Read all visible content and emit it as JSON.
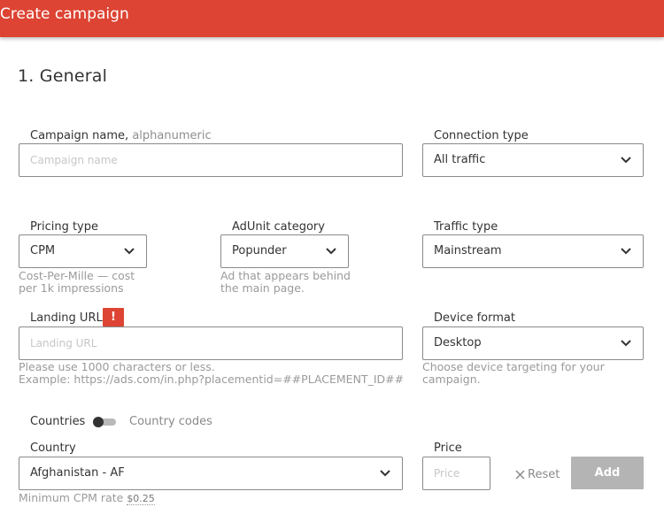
{
  "header": {
    "title": "Create campaign"
  },
  "section": {
    "title": "1. General"
  },
  "campaign_name": {
    "label": "Campaign name,",
    "hint": "alphanumeric",
    "placeholder": "Campaign name",
    "value": ""
  },
  "connection_type": {
    "label": "Connection type",
    "value": "All traffic"
  },
  "pricing_type": {
    "label": "Pricing type",
    "value": "CPM",
    "help_line1": "Cost-Per-Mille — cost",
    "help_line2": "per 1k impressions"
  },
  "adunit_category": {
    "label": "AdUnit category",
    "value": "Popunder",
    "help_line1": "Ad that appears behind",
    "help_line2": "the main page."
  },
  "traffic_type": {
    "label": "Traffic type",
    "value": "Mainstream"
  },
  "landing_url": {
    "label": "Landing URL",
    "alert": "!",
    "placeholder": "Landing URL",
    "value": "",
    "help_line1": "Please use 1000 characters or less.",
    "help_line2": "Example: https://ads.com/in.php?placementid=##PLACEMENT_ID##"
  },
  "device_format": {
    "label": "Device format",
    "value": "Desktop",
    "help_line1": "Choose device targeting for your",
    "help_line2": "campaign."
  },
  "countries_toggle": {
    "left_label": "Countries",
    "right_label": "Country codes"
  },
  "country": {
    "label": "Country",
    "value": "Afghanistan - AF",
    "min_label": "Minimum CPM rate",
    "min_value": "$0.25"
  },
  "price": {
    "label": "Price",
    "placeholder": "Price",
    "value": ""
  },
  "actions": {
    "reset_label": "Reset",
    "add_label": "Add"
  },
  "colors": {
    "accent": "#dd4433",
    "disabled_button": "#b4b4b4"
  }
}
